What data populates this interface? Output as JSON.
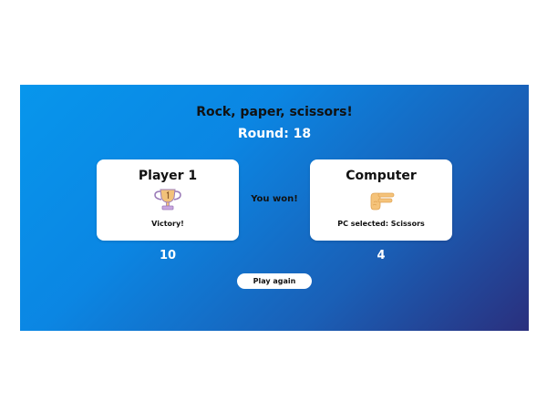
{
  "game": {
    "title": "Rock, paper, scissors!",
    "round_label": "Round: 18",
    "result_text": "You won!",
    "play_again_label": "Play again"
  },
  "player": {
    "name": "Player 1",
    "icon": "trophy-icon",
    "caption": "Victory!",
    "score": "10"
  },
  "computer": {
    "name": "Computer",
    "icon": "scissors-hand-icon",
    "caption": "PC selected: Scissors",
    "score": "4"
  },
  "colors": {
    "background_start": "#0796ec",
    "background_end": "#2a2f7d",
    "card": "#ffffff",
    "title_text": "#111111",
    "score_text": "#ffffff"
  }
}
